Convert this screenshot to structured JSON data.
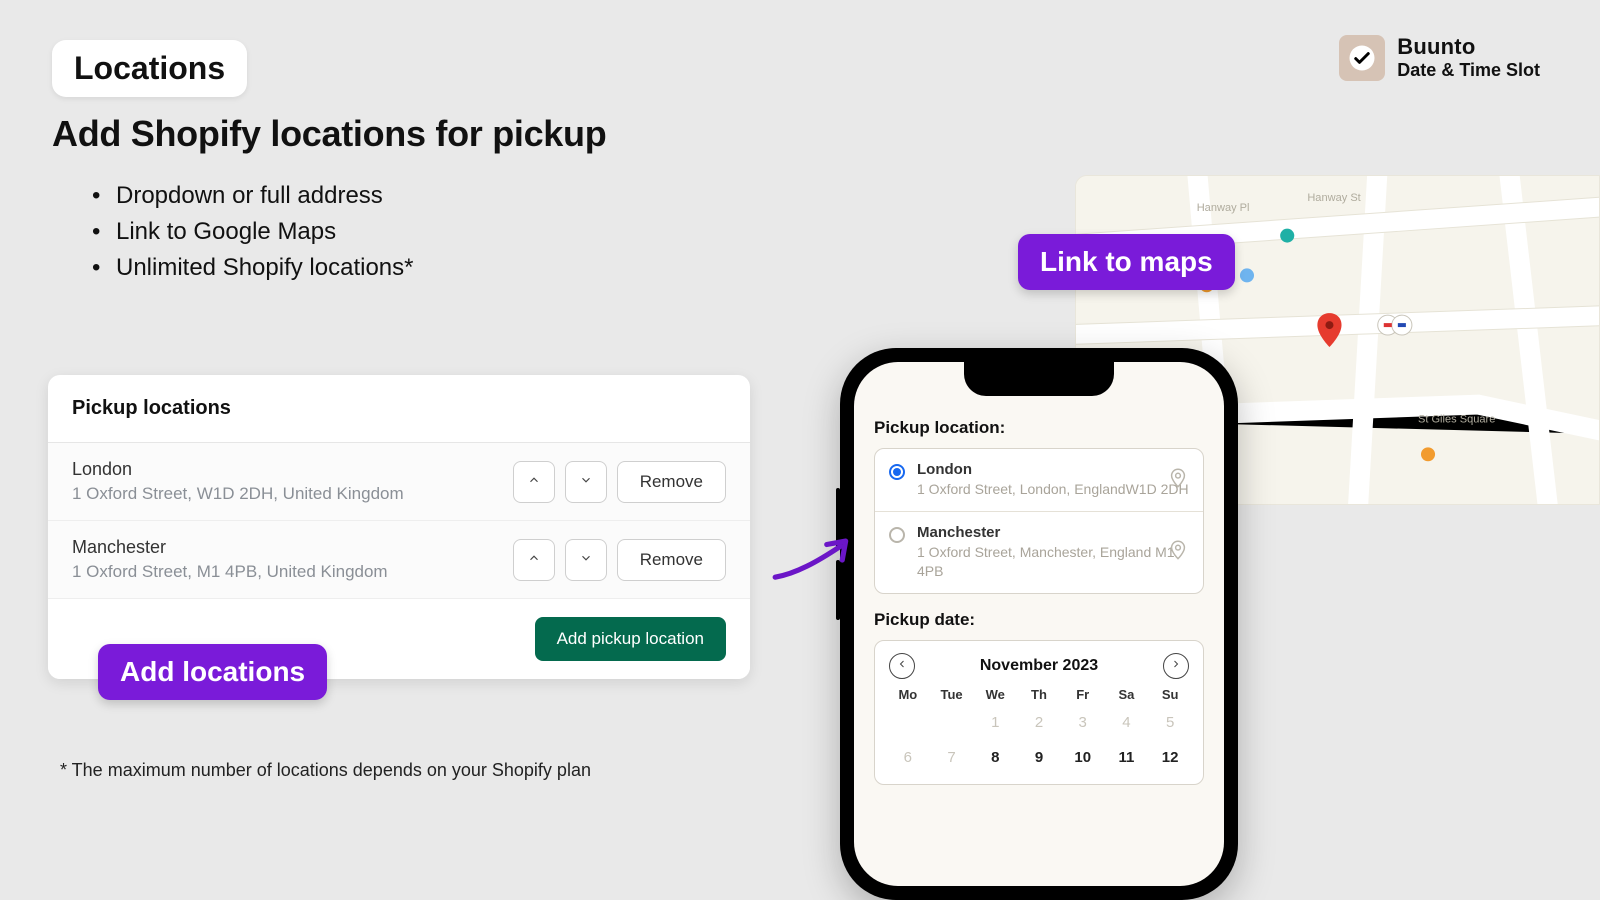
{
  "brand": {
    "name": "Buunto",
    "subtitle": "Date & Time Slot"
  },
  "heading": {
    "pill": "Locations",
    "sub": "Add Shopify locations for pickup",
    "bullets": [
      "Dropdown or full address",
      "Link to Google Maps",
      "Unlimited Shopify locations*"
    ],
    "footnote": "* The maximum number of locations depends on your Shopify plan"
  },
  "tags": {
    "add_locations": "Add locations",
    "link_to_maps": "Link to maps"
  },
  "admin": {
    "card_title": "Pickup locations",
    "add_button": "Add pickup location",
    "remove_label": "Remove",
    "rows": [
      {
        "name": "London",
        "address": "1 Oxford Street, W1D 2DH, United Kingdom"
      },
      {
        "name": "Manchester",
        "address": "1 Oxford Street, M1 4PB, United Kingdom"
      }
    ]
  },
  "phone": {
    "pickup_location_label": "Pickup location:",
    "pickup_date_label": "Pickup date:",
    "locations": [
      {
        "name": "London",
        "address": "1 Oxford Street, London, EnglandW1D 2DH",
        "selected": true
      },
      {
        "name": "Manchester",
        "address": "1 Oxford Street, Manchester, England M1 4PB",
        "selected": false
      }
    ],
    "month": "November 2023",
    "dow": [
      "Mo",
      "Tue",
      "We",
      "Th",
      "Fr",
      "Sa",
      "Su"
    ],
    "weeks": [
      [
        null,
        null,
        "1",
        "2",
        "3",
        "4",
        "5"
      ],
      [
        "6",
        "7",
        "8",
        "9",
        "10",
        "11",
        "12"
      ]
    ],
    "dim_days": [
      "1",
      "2",
      "3",
      "4",
      "5",
      "6",
      "7"
    ]
  },
  "colors": {
    "accent_purple": "#7a1bd9",
    "primary_green": "#046a4e"
  }
}
